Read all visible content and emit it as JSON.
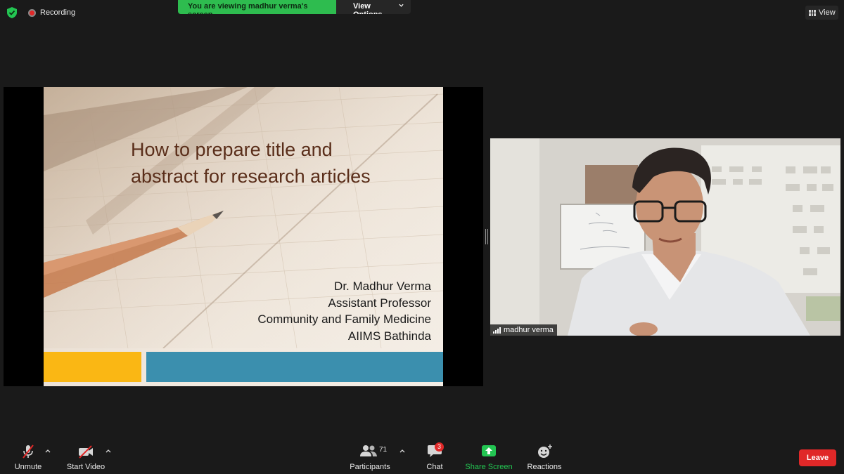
{
  "topbar": {
    "recording_label": "Recording",
    "share_banner": "You are viewing madhur verma's screen",
    "view_options_label": "View Options",
    "view_label": "View"
  },
  "slide": {
    "title_line1": "How to prepare title and",
    "title_line2": "abstract for research articles",
    "author": "Dr. Madhur Verma",
    "designation": "Assistant Professor",
    "department": "Community and Family Medicine",
    "institution": "AIIMS Bathinda",
    "bar_colors": [
      "#fab714",
      "#3b8fae"
    ]
  },
  "participant_video": {
    "name": "madhur verma",
    "icon": "signal-bars-icon"
  },
  "toolbar": {
    "unmute_label": "Unmute",
    "start_video_label": "Start Video",
    "participants_label": "Participants",
    "participants_count": "71",
    "chat_label": "Chat",
    "chat_badge": "3",
    "share_screen_label": "Share Screen",
    "reactions_label": "Reactions",
    "leave_label": "Leave"
  },
  "colors": {
    "share_banner_green": "#2ebc4f",
    "share_screen_icon": "#23c552",
    "leave_red": "#e02828",
    "slide_title": "#5a2e1a"
  }
}
